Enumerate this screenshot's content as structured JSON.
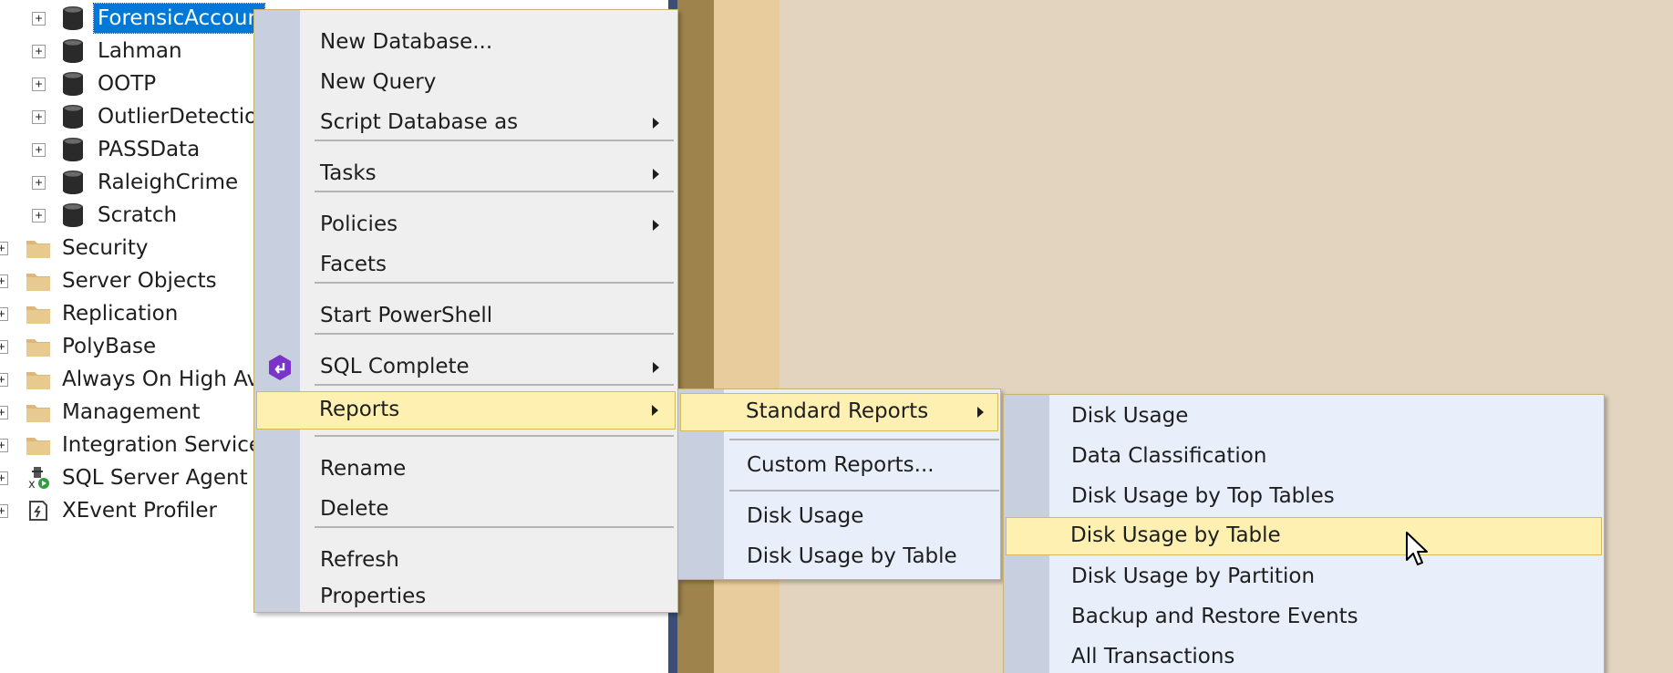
{
  "tree": {
    "databases": [
      {
        "label": "ForensicAccounting",
        "selected": true
      },
      {
        "label": "Lahman"
      },
      {
        "label": "OOTP"
      },
      {
        "label": "OutlierDetection"
      },
      {
        "label": "PASSData"
      },
      {
        "label": "RaleighCrime"
      },
      {
        "label": "Scratch"
      }
    ],
    "folders": [
      {
        "label": "Security",
        "icon": "folder-icon"
      },
      {
        "label": "Server Objects",
        "icon": "folder-icon"
      },
      {
        "label": "Replication",
        "icon": "folder-icon"
      },
      {
        "label": "PolyBase",
        "icon": "folder-icon"
      },
      {
        "label": "Always On High Availability",
        "icon": "folder-icon"
      },
      {
        "label": "Management",
        "icon": "folder-icon"
      },
      {
        "label": "Integration Services Catalogs",
        "icon": "folder-icon"
      },
      {
        "label": "SQL Server Agent",
        "icon": "sql-agent-icon"
      },
      {
        "label": "XEvent Profiler",
        "icon": "xevent-profiler-icon"
      }
    ],
    "expander_glyph": "+"
  },
  "context_menu": {
    "items": [
      {
        "label": "New Database..."
      },
      {
        "label": "New Query"
      },
      {
        "label": "Script Database as",
        "submenu": true
      },
      {
        "label": "Tasks",
        "submenu": true
      },
      {
        "label": "Policies",
        "submenu": true
      },
      {
        "label": "Facets"
      },
      {
        "label": "Start PowerShell"
      },
      {
        "label": "SQL Complete",
        "submenu": true,
        "icon": "sql-complete-icon"
      },
      {
        "label": "Reports",
        "submenu": true,
        "highlighted": true
      },
      {
        "label": "Rename"
      },
      {
        "label": "Delete"
      },
      {
        "label": "Refresh"
      },
      {
        "label": "Properties"
      }
    ]
  },
  "reports_menu": {
    "items": [
      {
        "label": "Standard Reports",
        "submenu": true,
        "highlighted": true
      },
      {
        "label": "Custom Reports..."
      },
      {
        "label": "Disk Usage"
      },
      {
        "label": "Disk Usage by Table"
      }
    ]
  },
  "standard_reports_menu": {
    "items": [
      {
        "label": "Disk Usage"
      },
      {
        "label": "Data Classification"
      },
      {
        "label": "Disk Usage by Top Tables"
      },
      {
        "label": "Disk Usage by Table",
        "highlighted": true
      },
      {
        "label": "Disk Usage by Partition"
      },
      {
        "label": "Backup and Restore Events"
      },
      {
        "label": "All Transactions"
      }
    ]
  },
  "colors": {
    "selection": "#0078d7",
    "menu_highlight": "#fdf0b0",
    "menu_border": "#c8b370",
    "gutter": "#c8cfdf",
    "folder": "#dcb67a"
  }
}
